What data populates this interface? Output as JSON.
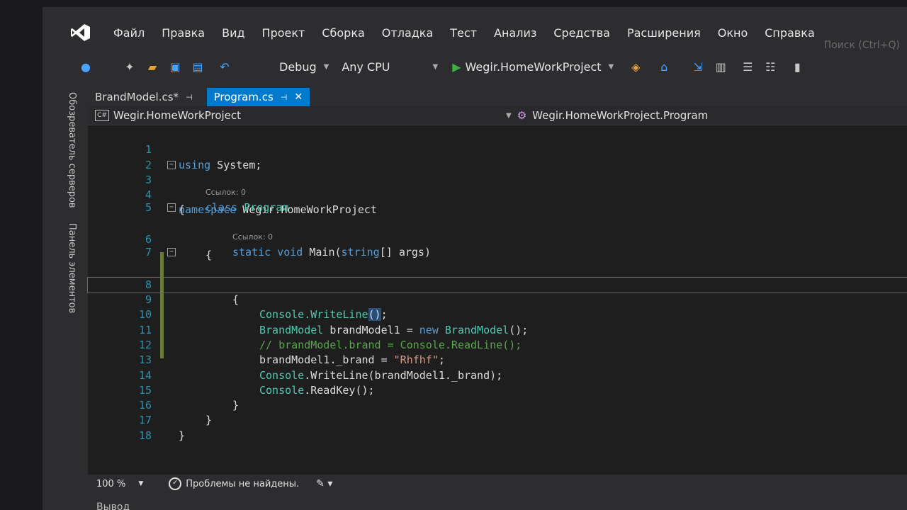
{
  "menu": [
    "Файл",
    "Правка",
    "Вид",
    "Проект",
    "Сборка",
    "Отладка",
    "Тест",
    "Анализ",
    "Средства",
    "Расширения",
    "Окно",
    "Справка"
  ],
  "search_placeholder": "Поиск (Ctrl+Q)",
  "toolbar": {
    "config": "Debug",
    "platform": "Any CPU",
    "run_target": "Wegir.HomeWorkProject"
  },
  "side_panels": [
    "Обозреватель серверов",
    "Панель элементов"
  ],
  "tabs": [
    {
      "label": "BrandModel.cs*",
      "active": false
    },
    {
      "label": "Program.cs",
      "active": true
    }
  ],
  "nav": {
    "project": "Wegir.HomeWorkProject",
    "member": "Wegir.HomeWorkProject.Program"
  },
  "hints": {
    "refs": "Ссылок: 0"
  },
  "code": {
    "lines": [
      "1",
      "2",
      "3",
      "4",
      "5",
      "6",
      "7",
      "8",
      "9",
      "10",
      "11",
      "12",
      "13",
      "14",
      "15",
      "16",
      "17",
      "18"
    ],
    "using": "using",
    "system": " System;",
    "namespace_kw": "namespace",
    "namespace_name": " Wegir.HomeWorkProject",
    "brace_open": "{",
    "brace_close": "}",
    "class_kw": "class",
    "class_name": " Program",
    "static_kw": "static",
    "void_kw": " void",
    "main_sig1": " Main(",
    "string_kw": "string",
    "main_sig2": "[] ",
    "args": "args",
    "main_sig3": ")",
    "console": "Console",
    "writeline": ".WriteLine",
    "paren_pair": "()",
    "semi": ";",
    "brandmodel_type": "BrandModel",
    "brandmodel_var": " brandModel1 = ",
    "new_kw": "new",
    "brandmodel_ctor": " BrandModel",
    "ctor_end": "();",
    "comment": "// brandModel.brand = Console.ReadLine();",
    "assign_lhs": "brandModel1._brand = ",
    "assign_str": "\"Rhfhf\"",
    "wl_arg": ".WriteLine(brandModel1._brand);",
    "readkey": ".ReadKey();"
  },
  "status": {
    "zoom": "100 %",
    "problems": "Проблемы не найдены."
  },
  "output_label": "Вывод",
  "colors": {
    "accent": "#007acc",
    "keyword": "#569cd6",
    "type": "#4ec9b0",
    "string": "#d69d85",
    "comment": "#57a64a"
  }
}
